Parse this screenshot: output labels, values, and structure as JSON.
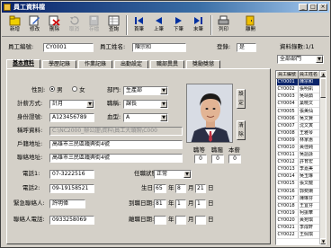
{
  "window": {
    "title": "員工資料檔"
  },
  "toolbar": {
    "buttons": [
      {
        "label": "新增",
        "icon": "new-record-icon",
        "disabled": false
      },
      {
        "label": "修改",
        "icon": "edit-icon",
        "disabled": false
      },
      {
        "label": "刪除",
        "icon": "delete-icon",
        "disabled": false
      },
      {
        "label": "取消",
        "icon": "undo-icon",
        "disabled": true
      },
      {
        "label": "存檔",
        "icon": "save-icon",
        "disabled": true
      },
      {
        "label": "查詢",
        "icon": "query-icon",
        "disabled": false
      },
      {
        "label": "首筆",
        "icon": "first-record-icon",
        "disabled": false
      },
      {
        "label": "上筆",
        "icon": "previous-record-icon",
        "disabled": false
      },
      {
        "label": "下筆",
        "icon": "next-record-icon",
        "disabled": false
      },
      {
        "label": "末筆",
        "icon": "last-record-icon",
        "disabled": false
      },
      {
        "label": "列印",
        "icon": "print-icon",
        "disabled": false
      },
      {
        "label": "離開",
        "icon": "exit-icon",
        "disabled": false
      }
    ]
  },
  "header": {
    "employee_no_label": "員工編號:",
    "employee_no": "CY0001",
    "employee_name_label": "員工姓名:",
    "employee_name": "陳宗和",
    "login_label": "登錄:",
    "login_value": "是",
    "record_count": "資料錄數:1/1"
  },
  "tabs": [
    "基本資料",
    "學歷記錄",
    "作業記錄",
    "出勤設定",
    "職部異異",
    "獎勵獎懲"
  ],
  "form": {
    "gender_label": "性別:",
    "gender_options": [
      "男",
      "女"
    ],
    "gender_value": "男",
    "dept_label": "部門:",
    "dept_value": "生產部",
    "pay_method_label": "計薪方式:",
    "pay_method_value": "計月",
    "position_label": "職稱:",
    "position_value": "課長",
    "id_label": "身份證號:",
    "id_value": "A123456789",
    "blood_label": "血型:",
    "blood_value": "A",
    "title_label": "稱呼資料:",
    "title_value": "C:\\NC2000_辦公證\\資料\\員工大頭照\\C000",
    "reg_addr_label": "戶籍地址:",
    "reg_addr_value": "高雄市三民區鐵興街4號",
    "mail_addr_label": "聯絡地址:",
    "mail_addr_value": "高雄市三民區鐵興街4號",
    "phone_label": "電話1:",
    "phone_value": "07-3222516",
    "phone2_label": "電話2:",
    "phone2_value": "09-19158521",
    "emergency_label": "緊急聯絡人:",
    "emergency_value": "許明偉",
    "emergency_phone_label": "聯絡人電話:",
    "emergency_phone_value": "0933258069",
    "status_label": "任職狀態:",
    "status_value": "正常",
    "birth_label": "生日:",
    "birth_year": "65",
    "birth_y_unit": "年",
    "birth_month": "8",
    "birth_m_unit": "月",
    "birth_day": "21",
    "birth_d_unit": "日",
    "hire_label": "到職日期:",
    "hire_year": "81",
    "hire_month": "1",
    "hire_day": "1",
    "leave_label": "離職日期:",
    "leave_year": "",
    "leave_month": "",
    "leave_day": "",
    "photo_set_btn": "設定",
    "photo_clear_btn": "清除",
    "counts_headers": [
      "職等",
      "職階",
      "本薪"
    ],
    "counts_values": [
      "0",
      "0",
      "0"
    ]
  },
  "sidebar": {
    "filter_value": "全部部門",
    "columns": [
      "員工編號",
      "員工姓名"
    ],
    "rows": [
      [
        "CY0001",
        "陳宗和"
      ],
      [
        "CY0002",
        "張明凱"
      ],
      [
        "CY0003",
        "吳靖茹"
      ],
      [
        "CY0004",
        "葉曉文"
      ],
      [
        "CY0005",
        "張美仙"
      ],
      [
        "CY0006",
        "吳文賢"
      ],
      [
        "CY0007",
        "沈文寅"
      ],
      [
        "CY0008",
        "王雅琴"
      ],
      [
        "CY0009",
        "林家惠"
      ],
      [
        "CY0010",
        "黃佳純"
      ],
      [
        "CY0011",
        "吳語詠"
      ],
      [
        "CY0012",
        "許育宏"
      ],
      [
        "CY0013",
        "李嘉美"
      ],
      [
        "CY0014",
        "吳玉琳"
      ],
      [
        "CY0015",
        "張文龍"
      ],
      [
        "CY0016",
        "郭奕姍"
      ],
      [
        "CY0017",
        "陳琳芬"
      ],
      [
        "CY0018",
        "王宜芬"
      ],
      [
        "CY0019",
        "柯振華"
      ],
      [
        "CY0020",
        "黃宛琪"
      ],
      [
        "CY0021",
        "李成軒"
      ],
      [
        "CY0022",
        "王佩琪"
      ]
    ]
  }
}
